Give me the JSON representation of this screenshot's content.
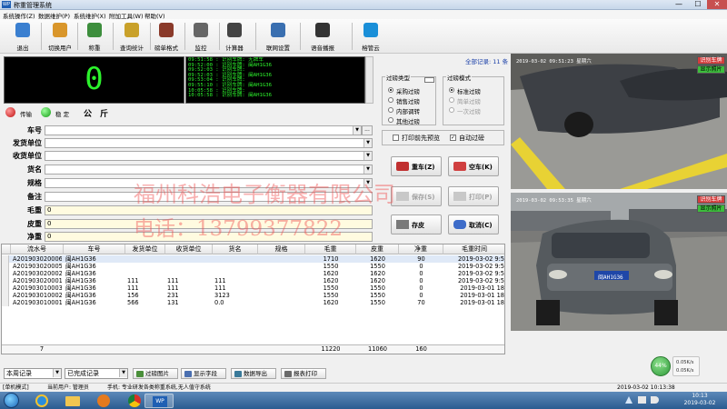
{
  "app": {
    "title": "称重管理系统",
    "window_controls": {
      "minimize": "—",
      "maximize": "☐",
      "close": "✕"
    }
  },
  "menu": [
    "系统操作(Z)",
    "数据维护(P)",
    "系统维护(X)",
    "附加工具(W)",
    "帮助(V)"
  ],
  "toolbar": [
    {
      "label": "退出",
      "icon": "exit-icon",
      "color": "#3a7fd0"
    },
    {
      "label": "切换用户",
      "icon": "switch-user-icon",
      "color": "#d9962b"
    },
    {
      "label": "称重",
      "icon": "weigh-icon",
      "color": "#3d8e3d"
    },
    {
      "label": "查询统计",
      "icon": "chart-icon",
      "color": "#c9a12a"
    },
    {
      "label": "磅单格式",
      "icon": "ticket-format-icon",
      "color": "#8a3a2a"
    },
    {
      "label": "监控",
      "icon": "camera-icon",
      "color": "#666666"
    },
    {
      "label": "计算器",
      "icon": "calculator-icon",
      "color": "#444444"
    },
    {
      "label": "联网设置",
      "icon": "network-icon",
      "color": "#3a6fb0"
    },
    {
      "label": "语音播报",
      "icon": "microphone-icon",
      "color": "#333333"
    },
    {
      "label": "榕管云",
      "icon": "cloud-icon",
      "color": "#1a8fd8"
    }
  ],
  "weight": {
    "value": "0",
    "unit": "公　斤",
    "transmit_label": "传输",
    "stable_label": "稳 定"
  },
  "log_lines": [
    "09:51:58 : 识别车牌: 无牌车",
    "09:52:00 : 识别车牌: 闽AH1G36",
    "09:52:03 : 识别车牌:",
    "09:52:03 : 识别车牌: 闽AH1G36",
    "09:53:04 : 识别车牌:",
    "09:55:10 : 识别车牌: 闽AH1G36",
    "10:05:58 : 识别车牌:",
    "10:05:58 : 识别车牌: 闽AH1G36"
  ],
  "form": {
    "plate": {
      "label": "车号",
      "value": "",
      "extra_button": "..."
    },
    "sender": {
      "label": "发货单位",
      "value": ""
    },
    "receiver": {
      "label": "收货单位",
      "value": ""
    },
    "goods": {
      "label": "货名",
      "value": ""
    },
    "spec": {
      "label": "规格",
      "value": ""
    },
    "remark": {
      "label": "备注",
      "value": ""
    },
    "gross": {
      "label": "毛重",
      "value": "0"
    },
    "tare": {
      "label": "皮重",
      "value": "0"
    },
    "net": {
      "label": "净重",
      "value": "0"
    }
  },
  "filter_type": {
    "title": "过磅类型",
    "options": [
      "采购过磅",
      "销售过磅",
      "内部调转",
      "其他过磅"
    ],
    "selected": 0
  },
  "filter_mode": {
    "title": "过磅模式",
    "options": [
      "标准过磅",
      "简单过磅",
      "一次过磅"
    ],
    "selected": 0
  },
  "checkboxes": {
    "print_preview": {
      "label": "打印前先预览",
      "checked": false
    },
    "auto_weigh": {
      "label": "自动过磅",
      "checked": true
    }
  },
  "actions": {
    "heavy": "重车(Z)",
    "empty": "空车(K)",
    "save": "保存(S)",
    "print": "打印(P)",
    "tare": "存皮",
    "cancel": "取消(C)"
  },
  "watermark": {
    "company": "福州科浩电子衡器有限公司",
    "phone": "电话：13799377822"
  },
  "table": {
    "total_label": "全部记录: 11 条",
    "columns": [
      "流水号",
      "车号",
      "发货单位",
      "收货单位",
      "货名",
      "规格",
      "毛重",
      "皮重",
      "净重",
      "毛重时间"
    ],
    "rows": [
      [
        "A201903020006",
        "闽AH1G36",
        "",
        "",
        "",
        "",
        "1710",
        "1620",
        "90",
        "2019-03-02 9:5"
      ],
      [
        "A201903020005",
        "闽AH1G36",
        "",
        "",
        "",
        "",
        "1550",
        "1550",
        "0",
        "2019-03-02 9:5"
      ],
      [
        "A201903020002",
        "闽AH1G36",
        "",
        "",
        "",
        "",
        "1620",
        "1620",
        "0",
        "2019-03-02 9:5"
      ],
      [
        "A201903020001",
        "闽AH1G36",
        "111",
        "111",
        "111",
        "",
        "1620",
        "1620",
        "0",
        "2019-03-02 9:5"
      ],
      [
        "A201903010003",
        "闽AH1G36",
        "111",
        "111",
        "111",
        "",
        "1550",
        "1550",
        "0",
        "2019-03-01 18"
      ],
      [
        "A201903010002",
        "闽AH1G36",
        "156",
        "231",
        "3123",
        "",
        "1550",
        "1550",
        "0",
        "2019-03-01 18"
      ],
      [
        "A201903010001",
        "闽AH1G36",
        "566",
        "131",
        "0.0",
        "",
        "1620",
        "1550",
        "70",
        "2019-03-01 18"
      ]
    ],
    "footer": {
      "count": "7",
      "gross": "11220",
      "tare": "11060",
      "net": "160"
    }
  },
  "bottom": {
    "range_select": "本周记录",
    "status_select": "已完成记录",
    "buttons": [
      "过磅图片",
      "显示字段",
      "数据导出",
      "报表打印"
    ]
  },
  "statusbar": {
    "mode": "[单机模式]",
    "user": "当前用户: 管理员",
    "tip": "手机: 专业研发各类称重系统,无人值守系统",
    "datetime": "2019-03-02 10:13:38"
  },
  "camera": {
    "top_timestamp": "2019-03-02 09:51:23 星期六",
    "bottom_timestamp": "2019-03-02 09:53:35 星期六",
    "recognize_label": "识别车牌",
    "show_photo_label": "显示照片",
    "plate_text": "闽AH1G36"
  },
  "network": {
    "percent": "44%",
    "up": "0.05K/s",
    "down": "0.05K/s"
  },
  "taskbar": {
    "time": "10:13",
    "date": "2019-03-02",
    "app_label": "WP"
  }
}
